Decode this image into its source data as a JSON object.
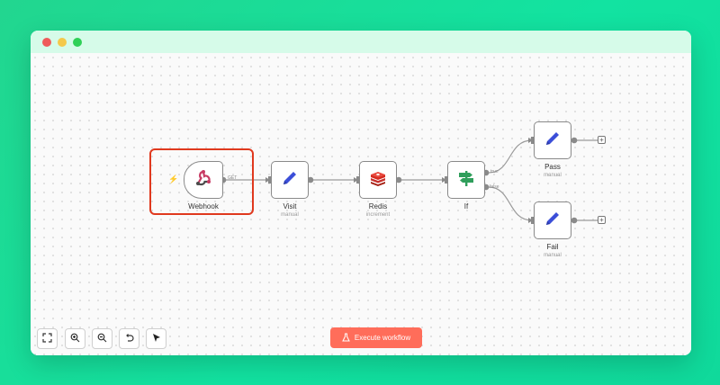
{
  "workflow": {
    "nodes": [
      {
        "id": "webhook",
        "label": "Webhook",
        "subtitle": "",
        "icon": "webhook-icon"
      },
      {
        "id": "visit",
        "label": "Visit",
        "subtitle": "manual",
        "icon": "pencil-icon"
      },
      {
        "id": "redis",
        "label": "Redis",
        "subtitle": "increment",
        "icon": "redis-icon"
      },
      {
        "id": "if",
        "label": "If",
        "subtitle": "",
        "icon": "signpost-icon"
      },
      {
        "id": "pass",
        "label": "Pass",
        "subtitle": "manual",
        "icon": "pencil-icon"
      },
      {
        "id": "fail",
        "label": "Fail",
        "subtitle": "manual",
        "icon": "pencil-icon"
      }
    ],
    "edge_labels": {
      "webhook_out": "GET",
      "if_true": "true",
      "if_false": "false"
    }
  },
  "toolbar": {
    "buttons": [
      {
        "name": "fit-view",
        "icon": "fullscreen-icon"
      },
      {
        "name": "zoom-in",
        "icon": "zoom-in-icon"
      },
      {
        "name": "zoom-out",
        "icon": "zoom-out-icon"
      },
      {
        "name": "undo",
        "icon": "undo-icon"
      },
      {
        "name": "select-tool",
        "icon": "cursor-icon"
      }
    ],
    "execute_label": "Execute workflow"
  },
  "colors": {
    "accent": "#ff6d5a",
    "selection": "#e0391e",
    "pencil": "#3b4ed8",
    "redis": "#d82c20",
    "signpost": "#2f9e5b"
  }
}
